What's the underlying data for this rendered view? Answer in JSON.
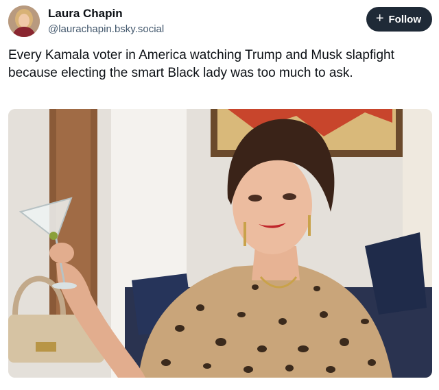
{
  "author": {
    "name": "Laura Chapin",
    "handle": "@laurachapin.bsky.social",
    "avatar_icon": "user-avatar"
  },
  "follow_button": {
    "icon": "plus-icon",
    "label": "Follow"
  },
  "post": {
    "text": "Every Kamala voter in America watching Trump and Musk slapfight because electing the smart Black lady was too much to ask."
  },
  "colors": {
    "button_bg": "#1f2a37",
    "handle_text": "#42576c"
  }
}
